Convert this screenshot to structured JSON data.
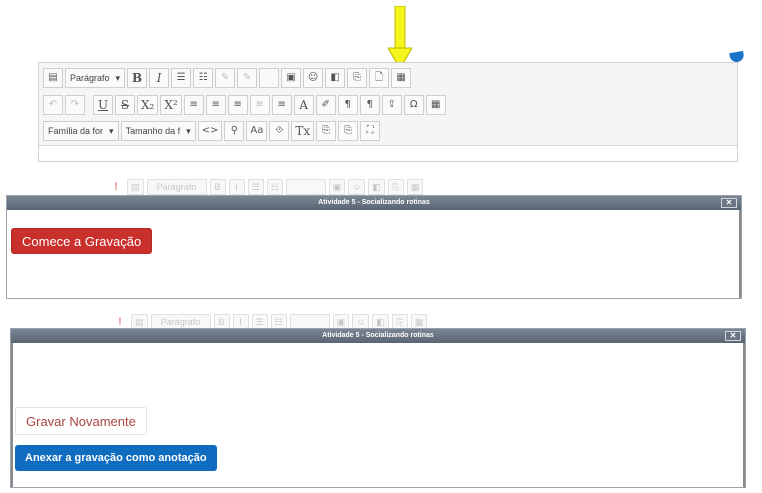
{
  "arrow_color": "#f5f51e",
  "editor": {
    "row1": {
      "paragraph_select": "Parágrafo",
      "buttons": [
        "B",
        "I",
        "☰",
        "☷",
        "✎",
        "✎",
        "",
        "▣",
        "☺",
        "◧",
        "⎘",
        "🗋",
        "▦"
      ]
    },
    "row2": {
      "buttons": [
        "↶",
        "↷",
        "U",
        "S",
        "X₂",
        "X²",
        "≡",
        "≡",
        "≡",
        "≡",
        "≡",
        "A",
        "✐",
        "¶",
        "¶",
        "⇪",
        "Ω",
        "▦"
      ]
    },
    "row3": {
      "font_family_select": "Família da for",
      "font_size_select": "Tamanho da f",
      "buttons": [
        "<>",
        "⚲",
        "Aa",
        "⟐",
        "Tx",
        "⎘",
        "⎘",
        "⛶"
      ]
    }
  },
  "ghost_bar": {
    "error_icon": "!",
    "paragraph_select": "Parágrafo"
  },
  "dialog1": {
    "title": "Atividade 5 - Socializando rotinas",
    "close_label": "✕",
    "record_button": "Comece a Gravação"
  },
  "dialog2": {
    "title": "Atividade 5 - Socializando rotinas",
    "close_label": "✕",
    "rerecord_button": "Gravar Novamente",
    "attach_button": "Anexar a gravação como anotação"
  },
  "colors": {
    "record_red": "#c9302c",
    "attach_blue": "#0f6cbf",
    "title_bar": "#5a6573"
  }
}
